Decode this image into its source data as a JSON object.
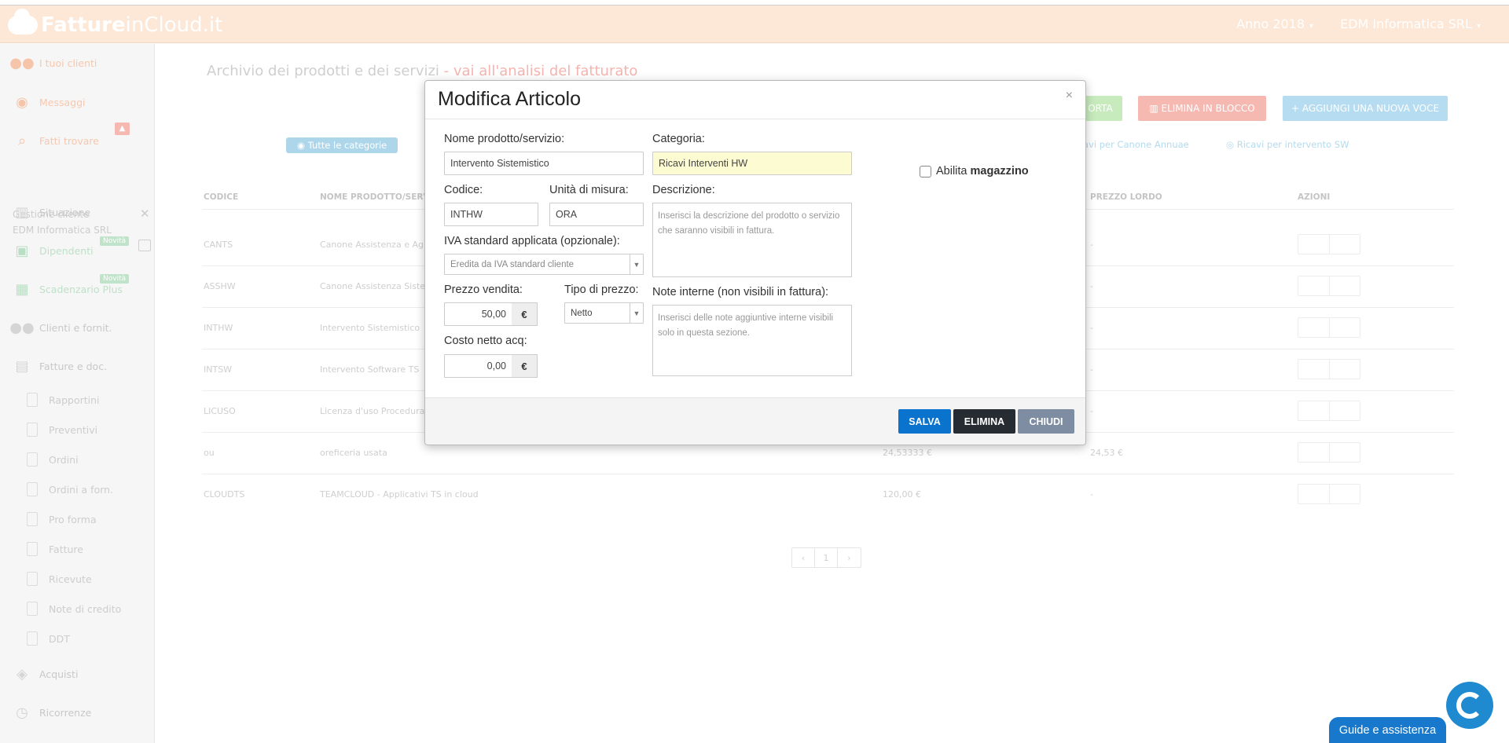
{
  "header": {
    "logo_bold": "Fatture",
    "logo_light": "inCloud.it",
    "year_menu": "Anno 2018",
    "company_menu": "EDM Informatica SRL"
  },
  "sidebar": {
    "items": [
      {
        "label": "I tuoi clienti",
        "icon": "users-icon"
      },
      {
        "label": "Messaggi",
        "icon": "chat-icon"
      },
      {
        "label": "Fatti trovare",
        "icon": "search-icon"
      },
      {
        "label": "Situazione",
        "icon": "bar-chart-icon"
      },
      {
        "label": "Dipendenti",
        "icon": "id-card-icon",
        "badge": "Novità"
      },
      {
        "label": "Scadenzario Plus",
        "icon": "calendar-icon",
        "badge": "Novità"
      },
      {
        "label": "Clienti e fornit.",
        "icon": "users-icon"
      },
      {
        "label": "Fatture e doc.",
        "icon": "document-icon"
      },
      {
        "label": "Acquisti",
        "icon": "tags-icon"
      },
      {
        "label": "Ricorrenze",
        "icon": "clock-icon"
      }
    ],
    "gestione_title": "Gestione cliente",
    "gestione_company": "EDM Informatica SRL",
    "sub_items": [
      "Rapportini",
      "Preventivi",
      "Ordini",
      "Ordini a forn.",
      "Pro forma",
      "Fatture",
      "Ricevute",
      "Note di credito",
      "DDT"
    ]
  },
  "page": {
    "title": "Archivio dei prodotti e dei servizi",
    "title_link": " - vai all'analisi del fatturato",
    "btn_export": "ORTA",
    "btn_delete_bulk": "ELIMINA IN BLOCCO",
    "btn_add": "+ AGGIUNGI UNA NUOVA VOCE",
    "cat_all": "Tutte le categorie",
    "cat_1": "avi per Canone Annuae",
    "cat_2": "Ricavi per intervento SW"
  },
  "table": {
    "headers": {
      "code": "CODICE",
      "name": "NOME PRODOTTO/SERVI",
      "gross": "PREZZO LORDO",
      "actions": "AZIONI"
    },
    "rows": [
      {
        "code": "CANTS",
        "name": "Canone Assistenza e Ag",
        "net": "",
        "gross": "-"
      },
      {
        "code": "ASSHW",
        "name": "Canone Assistenza Siste",
        "net": "",
        "gross": "-"
      },
      {
        "code": "INTHW",
        "name": "Intervento Sistemistico",
        "net": "",
        "gross": "-"
      },
      {
        "code": "INTSW",
        "name": "Intervento Software TS",
        "net": "",
        "gross": "-"
      },
      {
        "code": "LICUSO",
        "name": "Licenza d'uso Procedura",
        "net": "",
        "gross": "-"
      },
      {
        "code": "ou",
        "name": "oreficeria usata",
        "net": "24,53333 €",
        "gross": "24,53 €"
      },
      {
        "code": "CLOUDTS",
        "name": "TEAMCLOUD - Applicativi TS in cloud",
        "net": "120,00 €",
        "gross": "-"
      }
    ],
    "pager": {
      "prev": "‹",
      "page": "1",
      "next": "›"
    }
  },
  "modal": {
    "title": "Modifica Articolo",
    "close": "×",
    "name_label": "Nome prodotto/servizio:",
    "name_value": "Intervento Sistemistico",
    "category_label": "Categoria:",
    "category_value": "Ricavi Interventi HW",
    "code_label": "Codice:",
    "code_value": "INTHW",
    "unit_label": "Unità di misura:",
    "unit_value": "ORA",
    "desc_label": "Descrizione:",
    "desc_placeholder": "Inserisci la descrizione del prodotto o servizio che saranno visibili in fattura.",
    "iva_label": "IVA standard applicata (opzionale):",
    "iva_value": "Eredita da IVA standard cliente",
    "price_label": "Prezzo vendita:",
    "price_value": "50,00",
    "price_type_label": "Tipo di prezzo:",
    "price_type_value": "Netto",
    "notes_label": "Note interne (non visibili in fattura):",
    "notes_placeholder": "Inserisci delle note aggiuntive interne visibili solo in questa sezione.",
    "cost_label": "Costo netto acq:",
    "cost_value": "0,00",
    "currency": "€",
    "stock_label_prefix": "Abilita ",
    "stock_label_bold": "magazzino",
    "save": "SALVA",
    "delete": "ELIMINA",
    "close_btn": "CHIUDI"
  },
  "help": {
    "guide": "Guide e assistenza"
  },
  "colors": {
    "save": "#0a73cd",
    "delete": "#272c33",
    "close": "#7e8da1",
    "header_bg": "#fde7d6"
  }
}
